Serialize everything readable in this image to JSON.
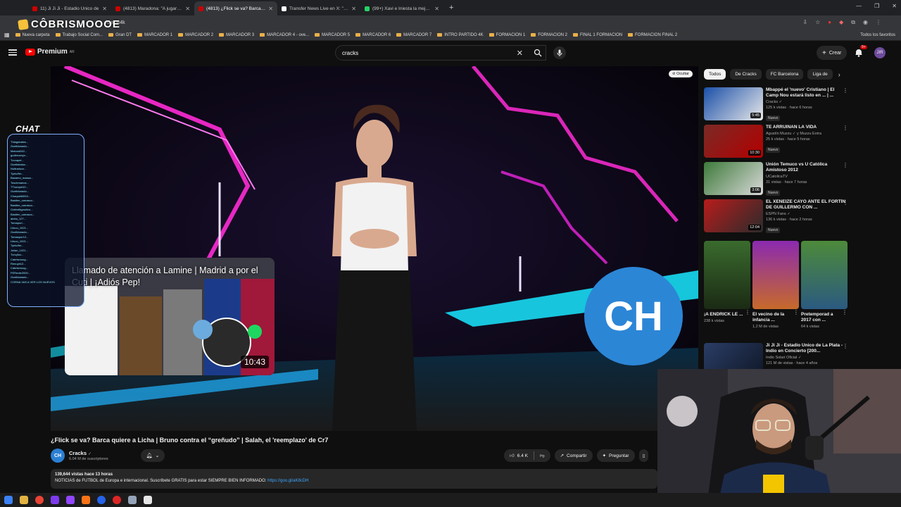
{
  "browser": {
    "tabs": [
      {
        "title": "11) Ji Ji Ji - Estadio Único de",
        "color": "#cc0000",
        "active": false
      },
      {
        "title": "(4813) Maradona: \"A jugar\" m",
        "color": "#cc0000",
        "active": false
      },
      {
        "title": "(4813) ¿Flick se va? Barca quie",
        "color": "#cc0000",
        "active": true
      },
      {
        "title": "Transfer News Live en X: \"🔺Bu",
        "color": "#ffffff",
        "active": false
      },
      {
        "title": "(99+) Xavi e Iniesta la mejor du",
        "color": "#25d366",
        "active": false
      }
    ],
    "url": "/Caxat4k",
    "bookmarks": [
      "Nueva carpeta",
      "Trabajo Social Com...",
      "Gran DT",
      "MARCADOR 1",
      "MARCADOR 2",
      "MARCADOR 3",
      "MARCADOR 4 - ove...",
      "MARCADOR 5",
      "MARCADOR 6",
      "MARCADOR 7",
      "INTRO PARTIDO 4K",
      "FORMACION 1",
      "FORMACION 2",
      "FINAL 1 FORMACION",
      "FORMACION FINAL 2"
    ],
    "all_bookmarks": "Todos los favoritos"
  },
  "overlay": {
    "logo_text": "CÔBRISMOOOE"
  },
  "youtube": {
    "logo": "Premium",
    "logo_region": "AR",
    "search_value": "cracks",
    "create": "Crear",
    "notif_badge": "9+",
    "avatar_text": "JIR"
  },
  "player": {
    "hide_chat": "Ocultar"
  },
  "chips": [
    "Todos",
    "De Cracks",
    "FC Barcelona",
    "Liga de"
  ],
  "recommendations": [
    {
      "title": "Mbappé el 'nuevo' Cristiano | El Camp Nou estará listo en ... | ...",
      "channel": "Cracks ✓",
      "views": "125 k vistas · hace 6 horas",
      "badge": "Nuevo",
      "duration": "5:45",
      "c1": "#1a4fa8",
      "c2": "#e9e9e9"
    },
    {
      "title": "TE ARRUINAN LA VIDA",
      "channel": "Agustín Muzzu ✓ y Muzzu Extra",
      "views": "25 k vistas · hace 5 horas",
      "badge": "Nuevo",
      "duration": "10:30",
      "c1": "#7a2a26",
      "c2": "#b30000"
    },
    {
      "title": "Unión Temuco vs U Católica Amistoso 2012",
      "channel": "UCatolicaTV",
      "views": "31 vistas · hace 7 horas",
      "badge": "Nuevo",
      "duration": "3:06",
      "c1": "#3d7a3a",
      "c2": "#d9d9d9"
    },
    {
      "title": "EL XENEIZE CAYÓ ANTE EL FORTÍN DE GUILLERMO CON ...",
      "channel": "ESPN Fans ✓",
      "views": "136 k vistas · hace 2 horas",
      "badge": "Nuevo",
      "duration": "12:04",
      "c1": "#b81c1c",
      "c2": "#2b2b2b"
    }
  ],
  "shorts": [
    {
      "title": "¡A ENDRICK LE ...",
      "views": "238 k vistas",
      "c1": "#3a6b2e",
      "c2": "#1b2a14"
    },
    {
      "title": "El vecino de la infancia ...",
      "views": "1,2 M de vistas",
      "c1": "#8b2ab0",
      "c2": "#c76a2a"
    },
    {
      "title": "Pretemporad a 2017 con ...",
      "views": "64 k vistas",
      "c1": "#4d8a3a",
      "c2": "#2b5a80"
    }
  ],
  "last_reco": {
    "title": "Ji Ji Ji - Estadio Único de La Plata - Indio en Concierto [200...",
    "channel": "Indio Solari Oficial ✓",
    "views": "121 M de vistas · hace 4 años"
  },
  "video": {
    "title": "¿Flick se va? Barca quiere a Licha | Bruno contra el “greñudo” | Salah, el 'reemplazo' de Cr7",
    "channel": "Cracks",
    "channel_initials": "CH",
    "subscribers": "6.04 M de suscriptores",
    "likes": "6.4 K",
    "share": "Compartir",
    "ask": "Preguntar",
    "views_meta": "139,644 vistas  hace 13 horas",
    "description": "NOTICIAS de FUTBOL de Europa e internacional. Suscríbete GRATIS para estar SIEMPRE BIEN INFORMADO: ",
    "link": "https://goo.gl/aK8cDH"
  },
  "embed": {
    "title": "Llamado de atención a Lamine | Madrid a por el Cuti | ¡Adiós Pep!",
    "duration": "10:43"
  },
  "chat": {
    "title": "CHAT",
    "messages": [
      "Thiagobales... ",
      "Guelldonado...",
      "Marcos042...",
      "godirruenyc...",
      "Turcapel...",
      "Guellaindoc...",
      "Nultraduzz...",
      "Tyelo/fer...",
      "Basamo_massa...",
      "Toscbmanca...",
      "TTrumpet10...",
      "Guelldonado...",
      "Chaqueti0810...",
      "Bastien_carrasco...",
      "Bastien_carrasco...",
      "Ozkhelltgmolivo...",
      "Bastien_carrasco...",
      "abelo_127...",
      "Tomaporl...",
      "Llluuu_1021...",
      "Guelldonado...",
      "Tomaspor12...",
      "Llluuu_1021...",
      "Tyelo/fer...",
      "Julian_1021...",
      "Turcyfoc...",
      "Cabrismoog...",
      "Renuyb12...",
      "Cabrismoog...",
      "FERnote2000...",
      "Guelldonado...",
      "CORNA VAS A VER LOS NUEVOS"
    ]
  }
}
